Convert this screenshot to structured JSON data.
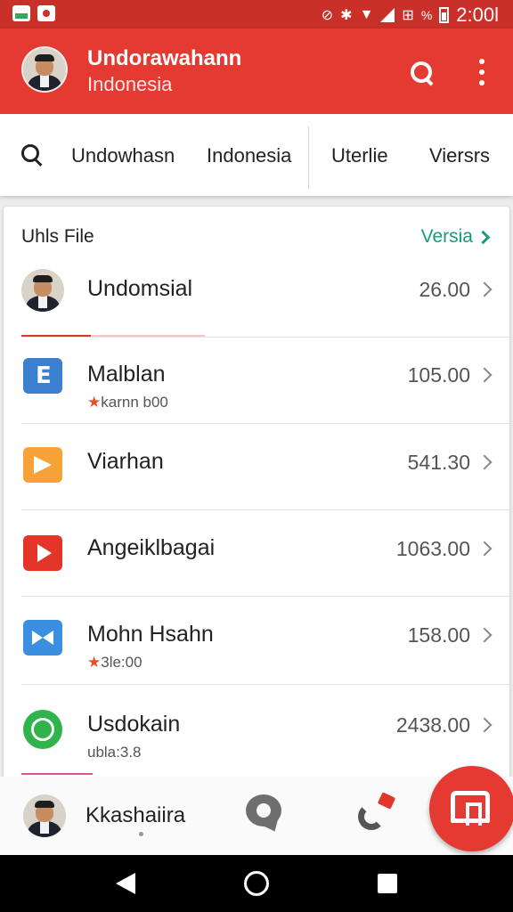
{
  "status_bar": {
    "battery_percent": "%",
    "time": "2:00l"
  },
  "app_bar": {
    "title": "Undorawahann",
    "subtitle": "Indonesia"
  },
  "tabs": [
    {
      "label": "Undowhasn"
    },
    {
      "label": "Indonesia"
    },
    {
      "label": "Uterlie"
    },
    {
      "label": "Viersrs"
    }
  ],
  "card": {
    "title": "Uhls File",
    "link_label": "Versia",
    "progress_fraction": 0.38,
    "rows": [
      {
        "name": "Undomsial",
        "sub": "",
        "value": "26.00",
        "icon": "person-avatar"
      },
      {
        "name": "Malblan",
        "sub": "karnn b00",
        "value": "105.00",
        "icon": "book-icon"
      },
      {
        "name": "Viarhan",
        "sub": "",
        "value": "541.30",
        "icon": "mail-icon"
      },
      {
        "name": "Angeiklbagai",
        "sub": "",
        "value": "1063.00",
        "icon": "play-icon"
      },
      {
        "name": "Mohn Hsahn",
        "sub": "3le:00",
        "value": "158.00",
        "icon": "mail-icon"
      },
      {
        "name": "Usdokain",
        "sub": "ubla:3.8",
        "value": "2438.00",
        "icon": "whatsapp-icon"
      }
    ]
  },
  "bottom_bar": {
    "name": "Kkashaiira"
  },
  "colors": {
    "primary": "#e53a32",
    "status_bar": "#c9302a",
    "link": "#1a9a7c"
  }
}
